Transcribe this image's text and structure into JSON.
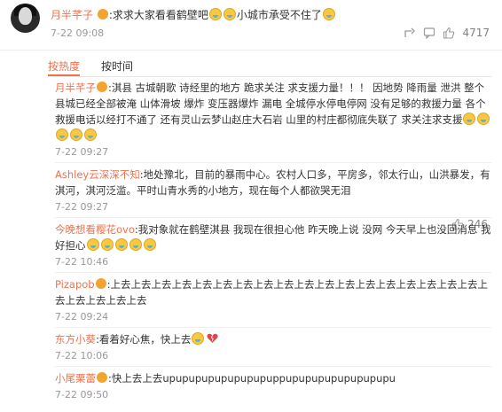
{
  "post": {
    "author": "月半芊子",
    "text_a": ":求求大家看看鹤壁吧",
    "text_b": "小城市承受不住了",
    "time": "7-22 09:08",
    "like_count": "4717"
  },
  "sort": {
    "hot_label": "按热度",
    "time_label": "按时间"
  },
  "comments": [
    {
      "author": "月半芊子",
      "text": ":淇县 古城朝歌 诗经里的地方 跪求关注 求支援力量！！！ 因地势 降雨量 泄洪 整个县城已经全部被淹 山体滑坡 爆炸 变压器爆炸 漏电 全城停水停电停网 没有足够的救援力量 各个救援电话以经打不通了 还有灵山云梦山赵庄大石岩 山里的村庄都彻底失联了 求关注求支援",
      "time": "7-22 09:27",
      "like_count": ""
    },
    {
      "author": "Ashley云深深不知",
      "text": ":地处豫北，目前的暴雨中心。农村人口多，平房多，邻太行山，山洪暴发，有淇河，淇河泛滥。平时山青水秀的小地方，现在每个人都欲哭无泪",
      "time": "7-22 09:27",
      "like_count": "246"
    },
    {
      "author": "今晚想看樱花ovo",
      "text": ":我对象就在鹤壁淇县 我现在很担心他 昨天晚上说 没网 今天早上也没回消息 我好担心",
      "time": "7-22 10:46",
      "like_count": ""
    },
    {
      "author": "Pizapob",
      "text": ":上去上去上去上去上去上去上去上去上去上去上去上去上去上去上去上去上去上去上去上去上去上去上去",
      "time": "7-22 09:24",
      "like_count": ""
    },
    {
      "author": "东方小葵",
      "text": ":看着好心焦，快上去",
      "time": "7-22 10:06",
      "like_count": ""
    },
    {
      "author": "小尾栗蕾",
      "text": ":快上去上去upupupupupupupupuppupupupupupupupupu",
      "time": "7-22 09:50",
      "like_count": ""
    }
  ],
  "colors": {
    "accent": "#eb7350",
    "muted": "#999999"
  }
}
